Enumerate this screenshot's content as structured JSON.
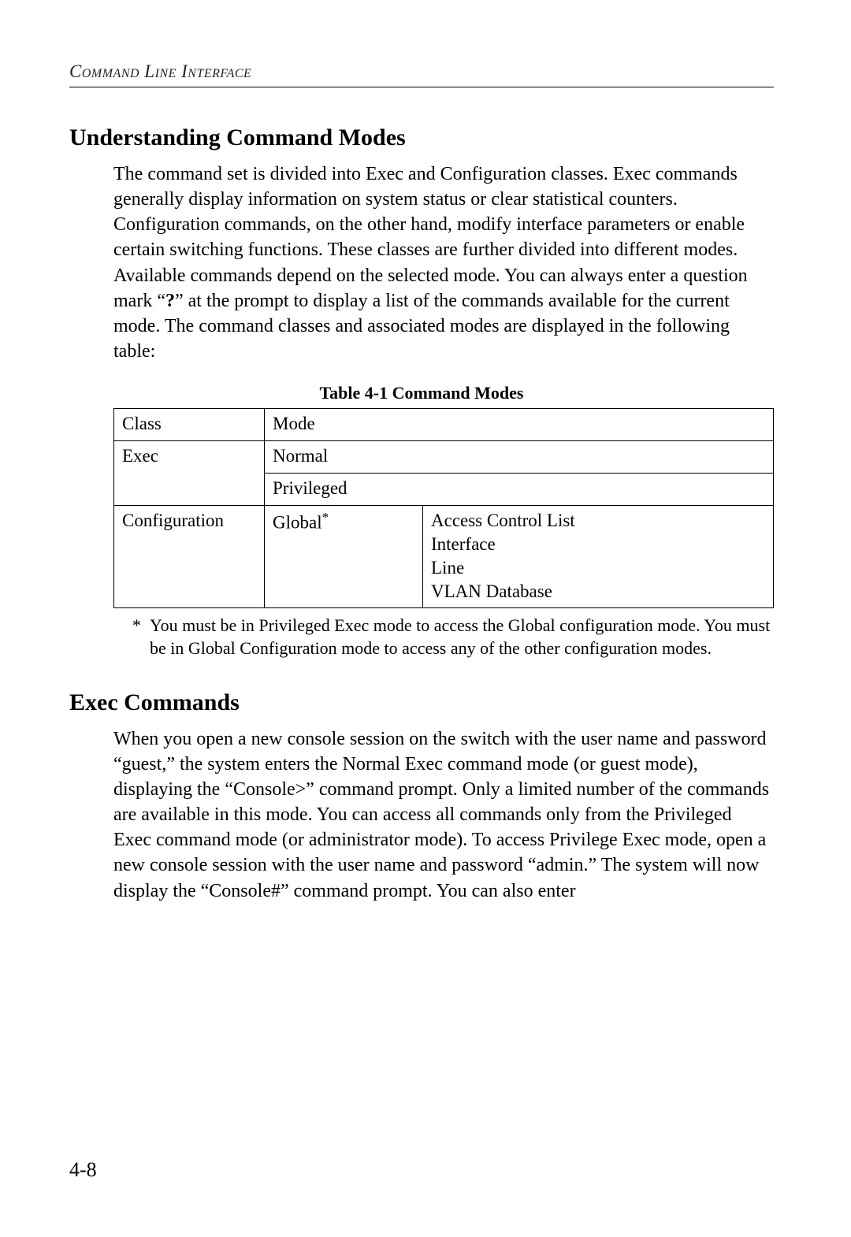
{
  "header": {
    "running_title": "Command Line Interface"
  },
  "section1": {
    "title": "Understanding Command Modes",
    "body_pre": "The command set is divided into Exec and Configuration classes. Exec commands generally display information on system status or clear statistical counters. Configuration commands, on the other hand, modify interface parameters or enable certain switching functions. These classes are further divided into different modes. Available commands depend on the selected mode. You can always enter a question mark “",
    "qmark": "?",
    "body_post": "” at the prompt to display a list of the commands available for the current mode. The command classes and associated modes are displayed in the following table:"
  },
  "table": {
    "caption": "Table 4-1  Command Modes",
    "header": {
      "col1": "Class",
      "col2": "Mode"
    },
    "rows": [
      {
        "class": "Exec",
        "mode_lines": [
          "Normal",
          "Privileged"
        ],
        "details": []
      },
      {
        "class": "Configuration",
        "mode_lines": [
          "Global*"
        ],
        "details": [
          "Access Control List",
          "Interface",
          "Line",
          "VLAN Database"
        ]
      }
    ],
    "footnote": "You must be in Privileged Exec mode to access the Global configuration mode. You must be in Global Configuration mode to access any of the other configuration modes."
  },
  "section2": {
    "title": "Exec Commands",
    "body": "When you open a new console session on the switch with the user name and password “guest,” the system enters the Normal Exec command mode (or guest mode), displaying the “Console>” command prompt. Only a limited number of the commands are available in this mode. You can access all commands only from the Privileged Exec command mode (or administrator mode). To access Privilege Exec mode, open a new console session with the user name and password “admin.” The system will now display the “Console#” command prompt. You can also enter"
  },
  "page_number": "4-8"
}
